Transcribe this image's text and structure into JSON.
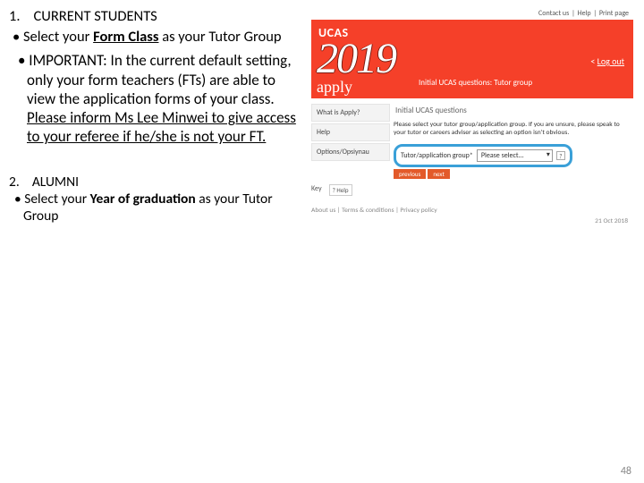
{
  "left": {
    "item1_num": "1.",
    "item1_title": "CURRENT STUDENTS",
    "b1_pre": "• Select your ",
    "b1_bold": "Form Class",
    "b1_post": " as your Tutor Group",
    "b2_pre": "• IMPORTANT: In the current default setting, only your form teachers (FTs) are able to view the application forms of your class. ",
    "b2_u": "Please inform Ms Lee Minwei to give access to your referee if he/she is not your FT.",
    "item2_num": "2.",
    "item2_title": "ALUMNI",
    "b3_pre": "• Select your ",
    "b3_bold": "Year of graduation",
    "b3_post": " as your Tutor Group"
  },
  "screenshot": {
    "toplinks": {
      "a": "Contact us",
      "b": "Help",
      "c": "Print page"
    },
    "ucas": "UCAS",
    "year": "2019",
    "apply": "apply",
    "subtitle": "Initial UCAS questions: Tutor group",
    "logout_prefix": "< ",
    "logout": "Log out",
    "sidebar": {
      "s1": "What is Apply?",
      "s2": "Help",
      "s3": "Options/Opsiynau"
    },
    "main_header": "Initial UCAS questions",
    "main_text": "Please select your tutor group/application group. If you are unsure, please speak to your tutor or careers adviser as selecting an option isn't obvious.",
    "select_label": "Tutor/application group*",
    "select_value": "Please select...",
    "qmark": "?",
    "key_label": "Key",
    "help_badge": "?  Help",
    "btn_prev": "previous",
    "btn_next": "next",
    "footer": "About us | Terms & conditions | Privacy policy",
    "footer_date": "21 Oct 2018"
  },
  "pagenum": "48"
}
